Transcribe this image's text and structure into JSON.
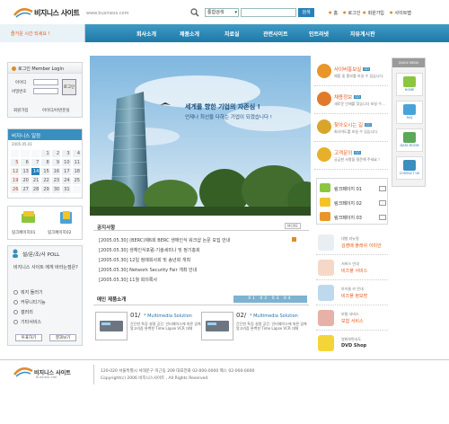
{
  "header": {
    "site_name": "비지니스 사이트",
    "url": "www.business.com",
    "search_select": "통합검색",
    "search_button": "검색",
    "links": [
      "홈",
      "로그인",
      "회원가입",
      "사이트맵"
    ]
  },
  "nav": {
    "welcome": "즐거운 시간 되세요 !",
    "items": [
      "회사소개",
      "제품소개",
      "자료실",
      "관련사이트",
      "인트라넷",
      "자유게시판"
    ]
  },
  "login": {
    "title": "로그인 Member Login",
    "id_label": "아이디",
    "pw_label": "비밀번호",
    "button": "로그인",
    "join": "회원가입",
    "find": "아이디/비번분실"
  },
  "calendar": {
    "title": "비지니스 일정",
    "subtitle": "2005.05.01",
    "weeks": [
      [
        "",
        "",
        "",
        "1",
        "2",
        "3",
        "4"
      ],
      [
        "5",
        "6",
        "7",
        "8",
        "9",
        "10",
        "11"
      ],
      [
        "12",
        "13",
        "14",
        "15",
        "16",
        "17",
        "18"
      ],
      [
        "19",
        "20",
        "21",
        "22",
        "23",
        "24",
        "25"
      ],
      [
        "26",
        "27",
        "28",
        "29",
        "30",
        "31",
        ""
      ]
    ],
    "today": "14"
  },
  "quick_links": [
    "링크페이지01",
    "링크페이지02"
  ],
  "poll": {
    "title": "설/문/조/사 POLL",
    "question": "비지니스 사이트 에게 바라는점은?",
    "options": [
      "뭐지 둘러기",
      "커뮤니티기능",
      "갤러리",
      "기타서비스"
    ],
    "vote_button": "투표하기",
    "result_button": "결과보기"
  },
  "hero": {
    "line1": "세계를 향한 기업의 자존심 !",
    "line2": "언제나 최선을 다하는 기업이 되겠습니다 !"
  },
  "news": {
    "title": "공지사항",
    "more": "MORE",
    "items": [
      "[2005.05.30] (BERC)제6회 BERC 생애인식 워크샵 논문 모집 안내",
      "[2005.05.30] 생체인식포럼-기술세미나 및 정기총회",
      "[2005.05.30] 12일 정례회사회 및 송년회 개최",
      "[2005.05.30] Network Security Fair 개최 안내",
      "[2005.05.30] 11월 회의록사"
    ]
  },
  "products": {
    "title": "메인 제품소개",
    "pager": "01 02 03 04",
    "items": [
      {
        "num": "01/",
        "name": "* Multimedia Solution",
        "desc": "간단한 특징 설명 공간. 인터페이스에 따른 압축 알고리즘 완벽한 Time Lapse VCR 대체"
      },
      {
        "num": "02/",
        "name": "* Multimedia Solution",
        "desc": "간단한 특징 설명 공간. 인터페이스에 따른 압축 알고리즘 완벽한 Time Lapse VCR 대체"
      }
    ]
  },
  "right_menu": [
    {
      "title": "사이버홍보실",
      "desc": "제품 및 홍보를 보실 수 있습니다.",
      "color": "#e8962a"
    },
    {
      "title": "채용정보",
      "desc": "새로운 인재를 찾습니다 보실 수...",
      "color": "#e07a2a"
    },
    {
      "title": "찾아오시는 길",
      "desc": "회사약도를 보실 수 있습니다.",
      "color": "#d9a42a"
    },
    {
      "title": "고객문의",
      "desc": "궁금한 사항을 질문해 주세요 !",
      "color": "#e8b02a"
    }
  ],
  "link_pages": [
    "링크페이지 01",
    "링크페이지 02",
    "링크페이지 03"
  ],
  "banners": [
    {
      "sub": "U-Shop",
      "sub2": "대형 리뉴얼",
      "title": "김영배 플래쉬 이미안"
    },
    {
      "sub": "서비스 안내",
      "title": "비즈플 서비스"
    },
    {
      "sub": "아이들 카 안내",
      "title": "비즈플 정보방"
    },
    {
      "sub": "보험 서비스",
      "title": "보험 서비스"
    },
    {
      "sub": "영화보면서도",
      "title": "DVD Shop"
    }
  ],
  "quick_menu": {
    "title": "QUICK MENU",
    "items": [
      "HOME",
      "FAQ",
      "DATA ROOM",
      "CONTACT US"
    ]
  },
  "footer": {
    "logo": "비지니스 사이트",
    "logo_sub": "Business Site",
    "address": "120-020 서울특별시 서대문구 미근동 209 대표전화 02-000-0000 팩스 02-000-0000",
    "copyright": "Copyright(c) 2006 비지니스사이트 , All Rights Reserved."
  },
  "colors": {
    "accent": "#2b80b8",
    "orange": "#e08a2a"
  }
}
